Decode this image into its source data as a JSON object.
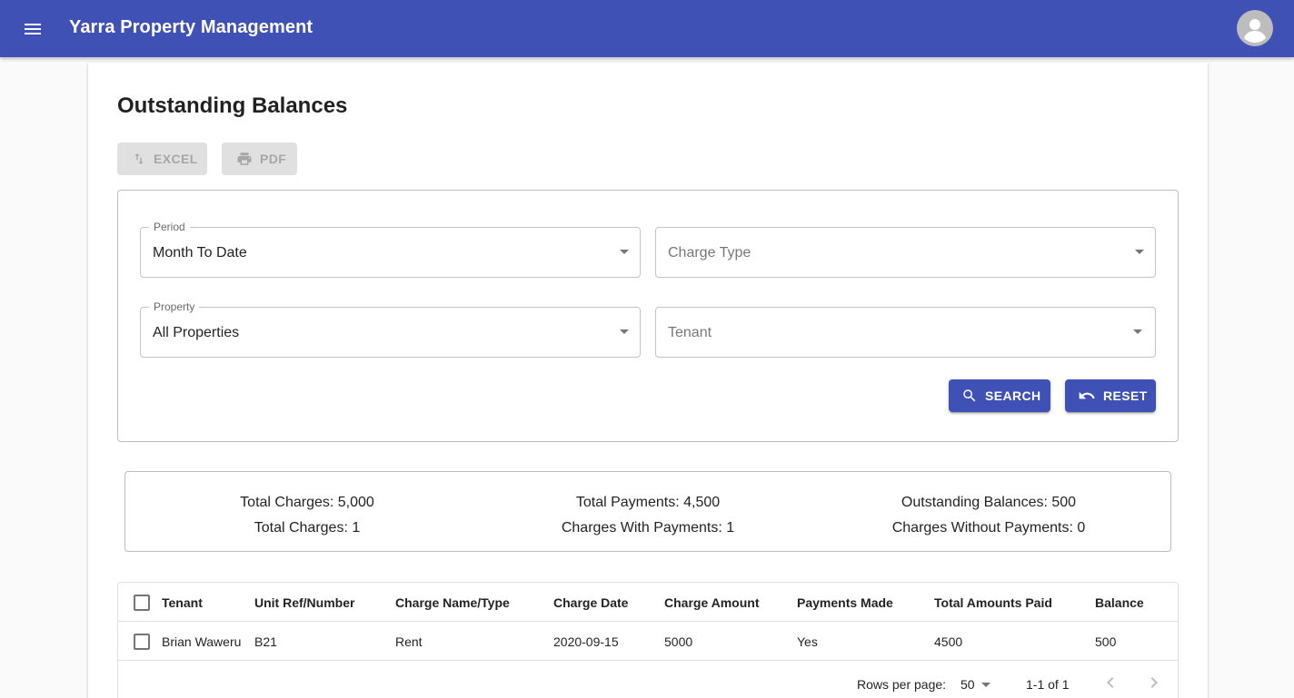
{
  "appbar": {
    "title": "Yarra Property Management"
  },
  "page": {
    "title": "Outstanding Balances"
  },
  "export": {
    "excel_label": "EXCEL",
    "pdf_label": "PDF"
  },
  "filters": {
    "period": {
      "label": "Period",
      "value": "Month To Date"
    },
    "charge_type": {
      "placeholder": "Charge Type"
    },
    "property": {
      "label": "Property",
      "value": "All Properties"
    },
    "tenant": {
      "placeholder": "Tenant"
    },
    "search_label": "SEARCH",
    "reset_label": "RESET"
  },
  "summary": {
    "total_charges_amount": "Total Charges: 5,000",
    "total_charges_count": "Total Charges: 1",
    "total_payments_amount": "Total Payments: 4,500",
    "charges_with_payments": "Charges With Payments: 1",
    "outstanding_balances": "Outstanding Balances: 500",
    "charges_without_payments": "Charges Without Payments: 0"
  },
  "table": {
    "columns": [
      "Tenant",
      "Unit Ref/Number",
      "Charge Name/Type",
      "Charge Date",
      "Charge Amount",
      "Payments Made",
      "Total Amounts Paid",
      "Balance"
    ],
    "rows": [
      [
        "Brian Waweru",
        "B21",
        "Rent",
        "2020-09-15",
        "5000",
        "Yes",
        "4500",
        "500"
      ]
    ]
  },
  "pagination": {
    "rows_per_page_label": "Rows per page:",
    "rows_per_page": "50",
    "range": "1-1 of 1"
  },
  "colors": {
    "primary": "#3f51b5"
  }
}
